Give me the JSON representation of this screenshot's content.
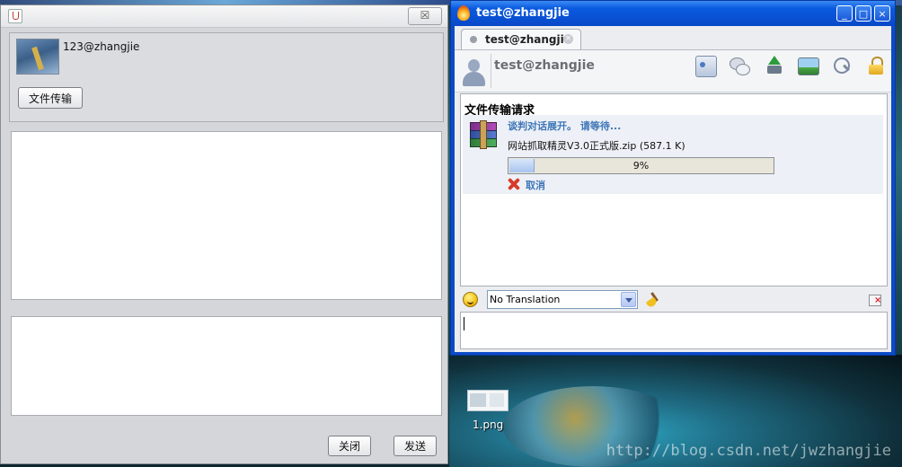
{
  "desktop": {
    "file_name": "1.png",
    "watermark": "http://blog.csdn.net/jwzhangjie"
  },
  "left_window": {
    "close_glyph": "☒",
    "username": "123@zhangjie",
    "file_transfer_button": "文件传输",
    "close_button": "关闭",
    "send_button": "发送"
  },
  "spark_window": {
    "title": "test@zhangjie",
    "controls": {
      "minimize": "_",
      "maximize": "□",
      "close": "×"
    },
    "tab": {
      "label": "test@zhangjie",
      "close_glyph": "×"
    },
    "contact_name": "test@zhangjie",
    "toolbar_icons": [
      "profile-card-icon",
      "chat-bubbles-icon",
      "send-file-icon",
      "screenshot-icon",
      "link-icon",
      "lock-icon"
    ],
    "transfer": {
      "heading": "文件传输请求",
      "status": "谈判对话展开。 请等待...",
      "file": "网站抓取精灵V3.0正式版.zip (587.1 K)",
      "progress_percent": 9,
      "progress_label": "9%",
      "cancel_label": "取消"
    },
    "translation": {
      "selected": "No Translation"
    }
  },
  "colors": {
    "spark_titlebar": "#0849c8",
    "link_blue": "#3f77b8",
    "cancel_red": "#d63a2a"
  }
}
